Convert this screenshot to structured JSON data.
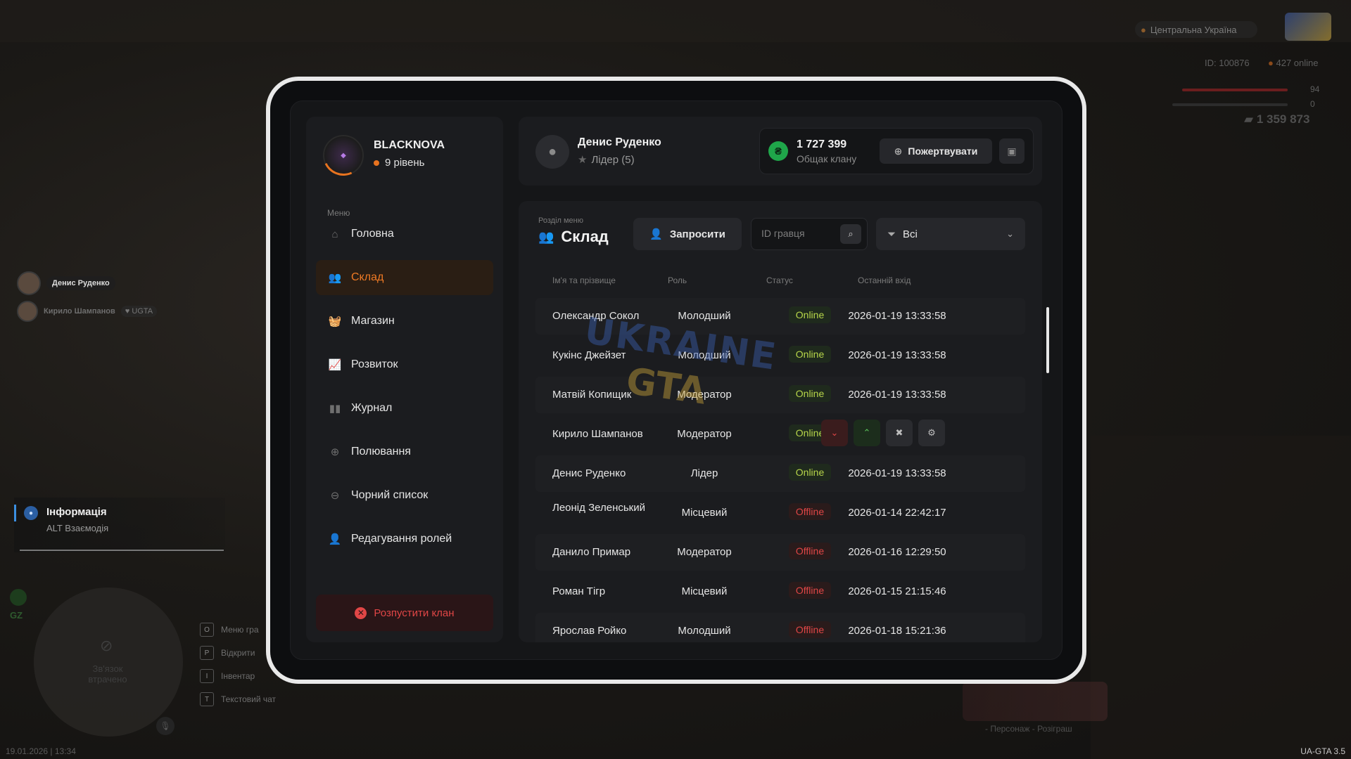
{
  "hud": {
    "region": "Центральна Україна",
    "server_id": "ID: 100876",
    "online": "427 online",
    "health": "94",
    "armor": "0",
    "money": "1 359 873",
    "players": [
      {
        "name": "Денис Руденко"
      },
      {
        "name": "Кирило Шампанов",
        "tag": "UGTA"
      }
    ],
    "info_title": "Інформація",
    "info_hint": "ALT Взаємодія",
    "gz": "GZ",
    "minimap_lost": "Зв'язок\nвтрачено",
    "key_hints": [
      {
        "key": "O",
        "label": "Меню гра"
      },
      {
        "key": "P",
        "label": "Відкрити"
      },
      {
        "key": "I",
        "label": "Інвентар"
      },
      {
        "key": "T",
        "label": "Текстовий чат"
      }
    ],
    "giveaway": "- Персонаж - Розіграш",
    "datetime": "19.01.2026 | 13:34",
    "version": "UA-GTA 3.5"
  },
  "sidebar": {
    "clan_name": "BLACKNOVA",
    "clan_level": "9 рівень",
    "menu_caption": "Меню",
    "items": [
      {
        "label": "Головна",
        "icon": "home-icon",
        "glyph": "⌂"
      },
      {
        "label": "Склад",
        "icon": "people-icon",
        "glyph": "👥"
      },
      {
        "label": "Магазин",
        "icon": "basket-icon",
        "glyph": "🧺"
      },
      {
        "label": "Розвиток",
        "icon": "chart-icon",
        "glyph": "📈"
      },
      {
        "label": "Журнал",
        "icon": "book-icon",
        "glyph": "▮▮"
      },
      {
        "label": "Полювання",
        "icon": "crosshair-icon",
        "glyph": "⊕"
      },
      {
        "label": "Чорний список",
        "icon": "blocked-icon",
        "glyph": "⊖"
      },
      {
        "label": "Редагування ролей",
        "icon": "user-edit-icon",
        "glyph": "👤"
      }
    ],
    "active_index": 1,
    "disband_label": "Розпустити клан"
  },
  "header": {
    "user_name": "Денис Руденко",
    "user_role": "Лідер (5)",
    "bank_amount": "1 727 399",
    "bank_label": "Общак клану",
    "donate_label": "Пожертвувати"
  },
  "panel": {
    "section_caption": "Розділ меню",
    "section_title": "Склад",
    "invite_label": "Запросити",
    "search_placeholder": "ID гравця",
    "filter_value": "Всі",
    "columns": [
      "Ім'я та прізвище",
      "Роль",
      "Статус",
      "Останній вхід"
    ],
    "rows": [
      {
        "name": "Олександр Сокол",
        "role": "Молодший",
        "status": "Online",
        "last": "2026-01-19 13:33:58"
      },
      {
        "name": "Кукінс Джейзет",
        "role": "Молодший",
        "status": "Online",
        "last": "2026-01-19 13:33:58"
      },
      {
        "name": "Матвій Копищик",
        "role": "Модератор",
        "status": "Online",
        "last": "2026-01-19 13:33:58"
      },
      {
        "name": "Кирило Шампанов",
        "role": "Модератор",
        "status": "Online",
        "last": ""
      },
      {
        "name": "Денис Руденко",
        "role": "Лідер",
        "status": "Online",
        "last": "2026-01-19 13:33:58"
      },
      {
        "name": "Леонід Зеленський",
        "role": "Місцевий",
        "status": "Offline",
        "last": "2026-01-14 22:42:17"
      },
      {
        "name": "Данило Примар",
        "role": "Модератор",
        "status": "Offline",
        "last": "2026-01-16 12:29:50"
      },
      {
        "name": "Роман Тігр",
        "role": "Місцевий",
        "status": "Offline",
        "last": "2026-01-15 21:15:46"
      },
      {
        "name": "Ярослав Ройко",
        "role": "Молодший",
        "status": "Offline",
        "last": "2026-01-18 15:21:36"
      }
    ]
  },
  "watermark": {
    "line1": "UKRAINE",
    "line2": "GTA"
  },
  "colors": {
    "accent": "#ef7a24",
    "online": "#b8d74a",
    "offline": "#e04646",
    "bank": "#1fa64a"
  }
}
